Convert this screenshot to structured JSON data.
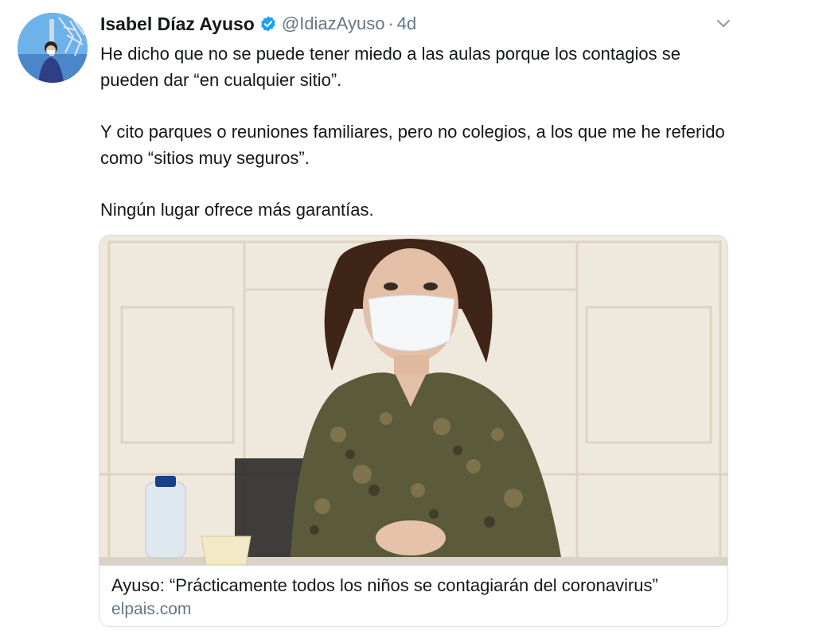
{
  "tweet": {
    "author_name": "Isabel Díaz Ayuso",
    "handle": "@IdiazAyuso",
    "separator": "·",
    "time": "4d",
    "verified": true,
    "paragraphs": [
      "He dicho que no se puede tener miedo a las aulas porque los contagios se pueden dar “en cualquier sitio”.",
      "Y cito parques o reuniones familiares, pero no colegios, a los que me he referido como “sitios muy seguros”.",
      "Ningún lugar ofrece más garantías."
    ]
  },
  "card": {
    "title": "Ayuso: “Prácticamente todos los niños se contagiarán del coronavirus”",
    "domain": "elpais.com"
  },
  "icons": {
    "verified": "verified-badge-icon",
    "menu": "chevron-down-icon"
  },
  "colors": {
    "verified_blue": "#1da1f2",
    "secondary_text": "#657786",
    "primary_text": "#14171a",
    "border": "#d7dee3"
  }
}
